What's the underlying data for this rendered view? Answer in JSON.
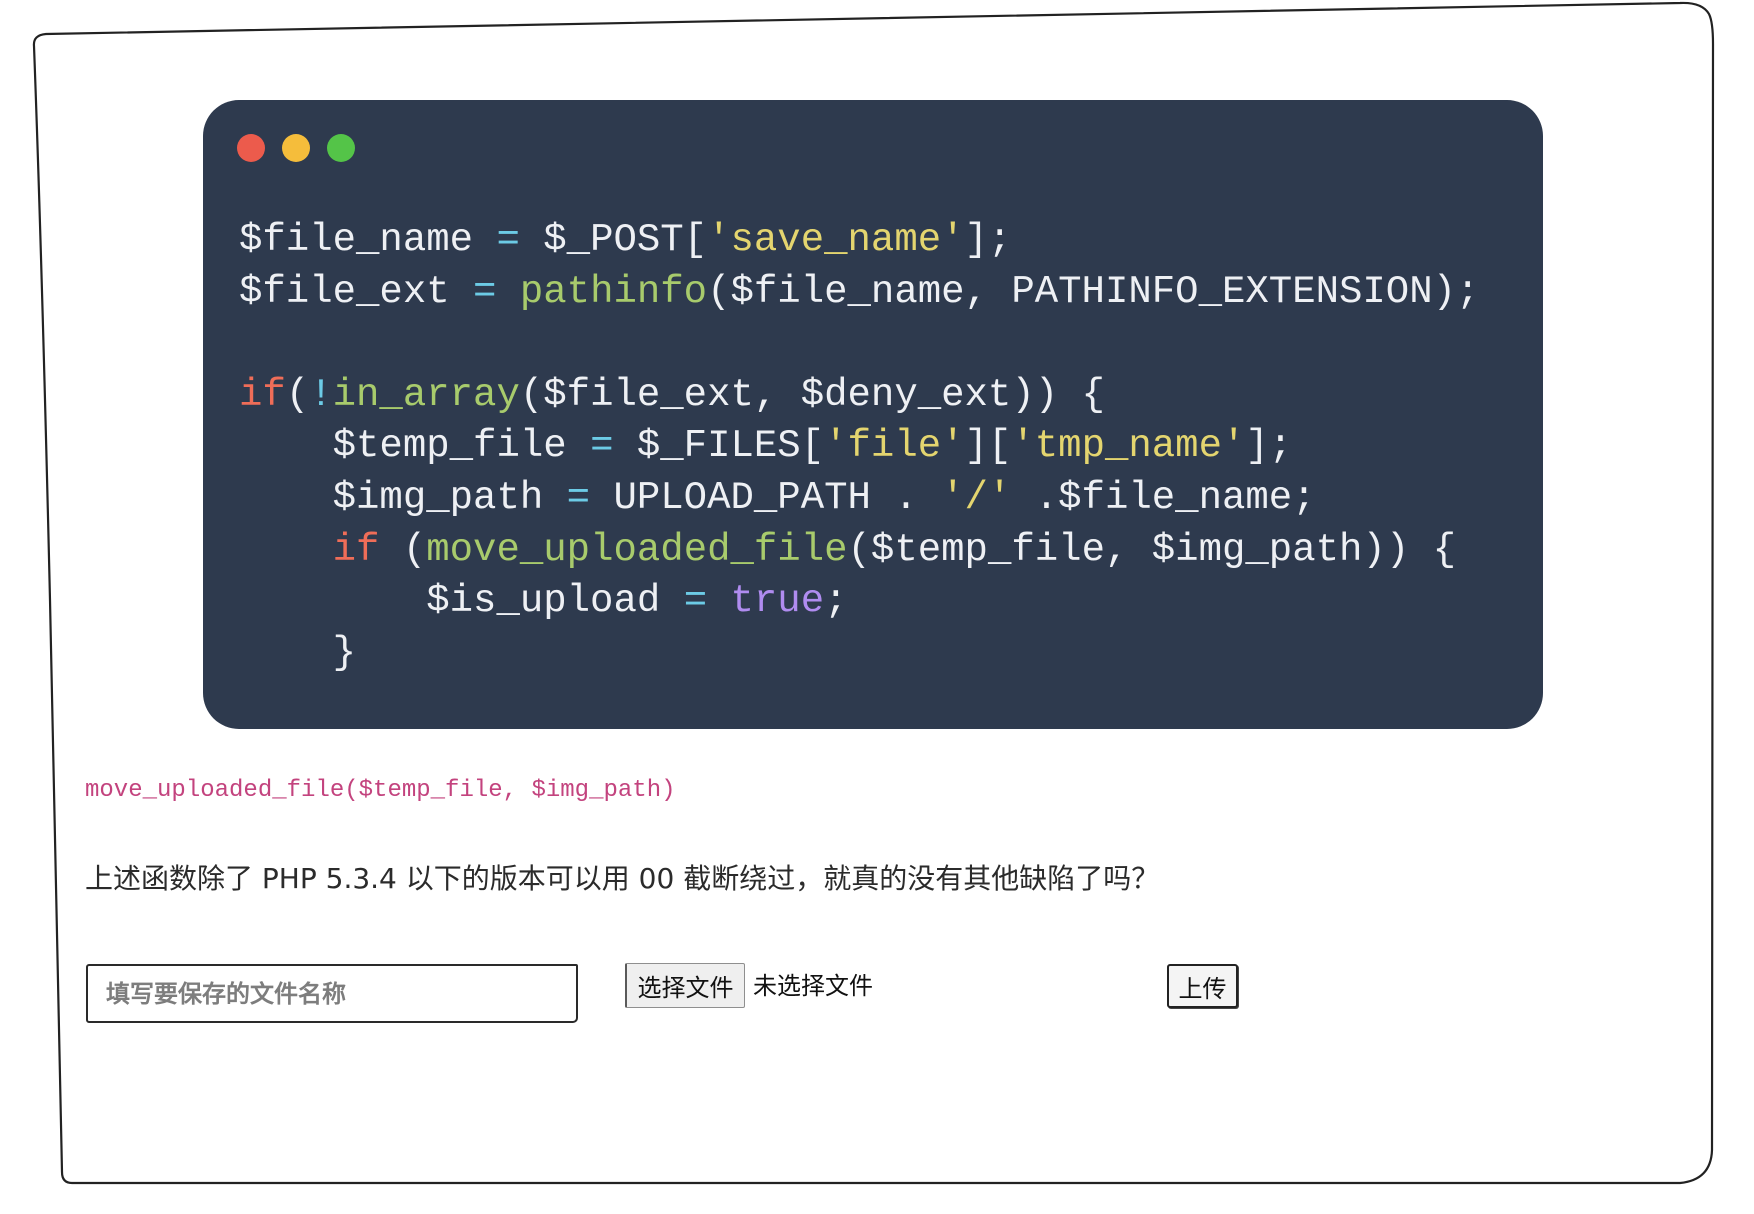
{
  "code_window": {
    "controls": [
      {
        "icon": "close-dot",
        "color": "#ec5b4c"
      },
      {
        "icon": "minimize-dot",
        "color": "#f5bd3b"
      },
      {
        "icon": "zoom-dot",
        "color": "#54c448"
      }
    ],
    "background": "#2e3a4e",
    "colors": {
      "plain": "#eef0f4",
      "op": "#6ccbe6",
      "str": "#e4d56f",
      "fn": "#a8cb6c",
      "kw": "#ef6d58",
      "bool": "#b08cf0"
    },
    "lines": [
      [
        {
          "t": "$file_name ",
          "c": "plain"
        },
        {
          "t": "=",
          "c": "op"
        },
        {
          "t": " $_POST[",
          "c": "plain"
        },
        {
          "t": "'save_name'",
          "c": "str"
        },
        {
          "t": "];",
          "c": "plain"
        }
      ],
      [
        {
          "t": "$file_ext ",
          "c": "plain"
        },
        {
          "t": "=",
          "c": "op"
        },
        {
          "t": " pathinfo",
          "c": "fn"
        },
        {
          "t": "($file_name, PATHINFO_EXTENSION);",
          "c": "plain"
        }
      ],
      [],
      [
        {
          "t": "if",
          "c": "kw"
        },
        {
          "t": "(",
          "c": "plain"
        },
        {
          "t": "!",
          "c": "op"
        },
        {
          "t": "in_array",
          "c": "fn"
        },
        {
          "t": "($file_ext, $deny_ext)) {",
          "c": "plain"
        }
      ],
      [
        {
          "t": "    $temp_file ",
          "c": "plain"
        },
        {
          "t": "=",
          "c": "op"
        },
        {
          "t": " $_FILES[",
          "c": "plain"
        },
        {
          "t": "'file'",
          "c": "str"
        },
        {
          "t": "][",
          "c": "plain"
        },
        {
          "t": "'tmp_name'",
          "c": "str"
        },
        {
          "t": "];",
          "c": "plain"
        }
      ],
      [
        {
          "t": "    $img_path ",
          "c": "plain"
        },
        {
          "t": "=",
          "c": "op"
        },
        {
          "t": " UPLOAD_PATH . ",
          "c": "plain"
        },
        {
          "t": "'/'",
          "c": "str"
        },
        {
          "t": " .$file_name;",
          "c": "plain"
        }
      ],
      [
        {
          "t": "    if",
          "c": "kw"
        },
        {
          "t": " (",
          "c": "plain"
        },
        {
          "t": "move_uploaded_file",
          "c": "fn"
        },
        {
          "t": "($temp_file, $img_path)) {",
          "c": "plain"
        }
      ],
      [
        {
          "t": "        $is_upload ",
          "c": "plain"
        },
        {
          "t": "=",
          "c": "op"
        },
        {
          "t": " true",
          "c": "bool"
        },
        {
          "t": ";",
          "c": "plain"
        }
      ],
      [
        {
          "t": "    }",
          "c": "plain"
        }
      ]
    ]
  },
  "inline_code": "move_uploaded_file($temp_file, $img_path)",
  "question": "上述函数除了 PHP 5.3.4 以下的版本可以用 00 截断绕过，就真的没有其他缺陷了吗？",
  "form": {
    "filename_placeholder": "填写要保存的文件名称",
    "filename_value": "",
    "choose_file_label": "选择文件",
    "no_file_text": "未选择文件",
    "upload_label": "上传"
  }
}
